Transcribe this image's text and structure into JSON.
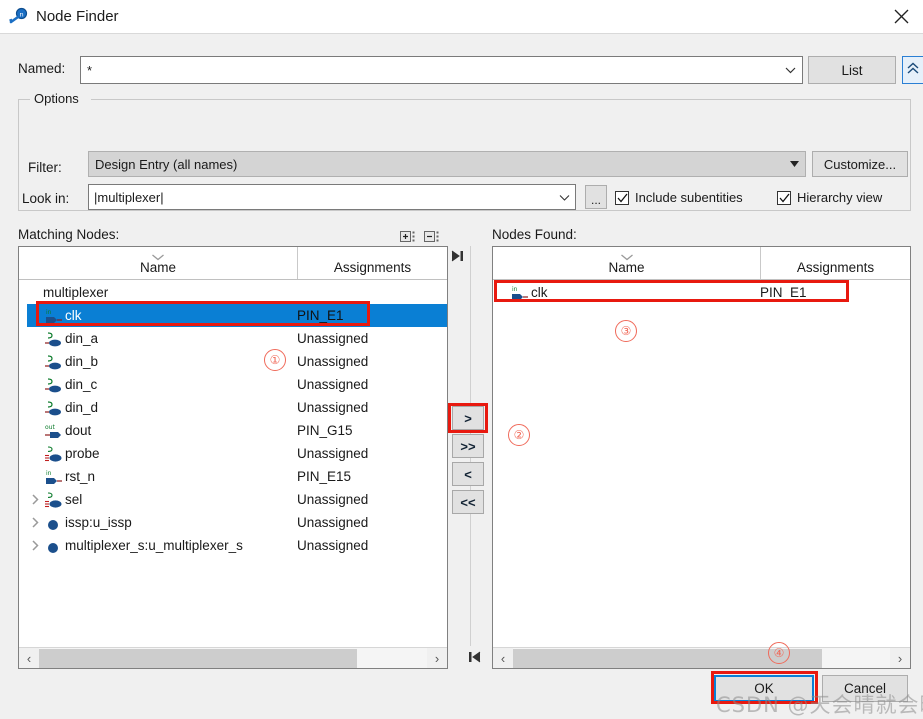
{
  "window": {
    "title": "Node Finder",
    "app_icon": "magnifier-icon",
    "close_label": "×"
  },
  "named": {
    "label": "Named:",
    "value": "*",
    "list_button": "List",
    "collapse_button": "«"
  },
  "options": {
    "legend": "Options",
    "filter_label": "Filter:",
    "filter_value": "Design Entry (all names)",
    "customize_button": "Customize...",
    "lookin_label": "Look in:",
    "lookin_value": "|multiplexer|",
    "browse_button": "...",
    "include_subentities": {
      "label": "Include subentities",
      "checked": true
    },
    "hierarchy_view": {
      "label": "Hierarchy view",
      "checked": true
    }
  },
  "matching": {
    "section_label": "Matching Nodes:",
    "columns": {
      "name": "Name",
      "assignments": "Assignments"
    },
    "rows": [
      {
        "name": "multiplexer",
        "assignment": "",
        "icon": "none",
        "twisty": false,
        "root": true,
        "selected": false
      },
      {
        "name": "clk",
        "assignment": "PIN_E1",
        "icon": "input-pin",
        "twisty": false,
        "root": false,
        "selected": true
      },
      {
        "name": "din_a",
        "assignment": "Unassigned",
        "icon": "bidir-node",
        "twisty": false,
        "root": false,
        "selected": false
      },
      {
        "name": "din_b",
        "assignment": "Unassigned",
        "icon": "bidir-node",
        "twisty": false,
        "root": false,
        "selected": false
      },
      {
        "name": "din_c",
        "assignment": "Unassigned",
        "icon": "bidir-node",
        "twisty": false,
        "root": false,
        "selected": false
      },
      {
        "name": "din_d",
        "assignment": "Unassigned",
        "icon": "bidir-node",
        "twisty": false,
        "root": false,
        "selected": false
      },
      {
        "name": "dout",
        "assignment": "PIN_G15",
        "icon": "output-pin",
        "twisty": false,
        "root": false,
        "selected": false
      },
      {
        "name": "probe",
        "assignment": "Unassigned",
        "icon": "bus-node",
        "twisty": false,
        "root": false,
        "selected": false
      },
      {
        "name": "rst_n",
        "assignment": "PIN_E15",
        "icon": "input-pin",
        "twisty": false,
        "root": false,
        "selected": false
      },
      {
        "name": "sel",
        "assignment": "Unassigned",
        "icon": "bus-node",
        "twisty": true,
        "root": false,
        "selected": false
      },
      {
        "name": "issp:u_issp",
        "assignment": "Unassigned",
        "icon": "instance",
        "twisty": true,
        "root": false,
        "selected": false
      },
      {
        "name": "multiplexer_s:u_multiplexer_s",
        "assignment": "Unassigned",
        "icon": "instance",
        "twisty": true,
        "root": false,
        "selected": false
      }
    ],
    "expand_all_icon": "expand-all-icon",
    "collapse_all_icon": "collapse-all-icon"
  },
  "found": {
    "section_label": "Nodes Found:",
    "columns": {
      "name": "Name",
      "assignments": "Assignments"
    },
    "rows": [
      {
        "name": "clk",
        "assignment": "PIN_E1",
        "icon": "input-pin"
      }
    ]
  },
  "transfer": {
    "add_one": ">",
    "add_all": ">>",
    "remove_one": "<",
    "remove_all": "<<"
  },
  "footer": {
    "ok": "OK",
    "cancel": "Cancel"
  },
  "annotations": {
    "num1": "①",
    "num2": "②",
    "num3": "③",
    "num4": "④"
  },
  "watermark": "CSDN @天会晴就会暗",
  "colors": {
    "selection_blue": "#0a7fd4",
    "annotation_red": "#e8190f",
    "annotation_circle": "#f06a5a",
    "dialog_bg": "#f0f0f0"
  }
}
